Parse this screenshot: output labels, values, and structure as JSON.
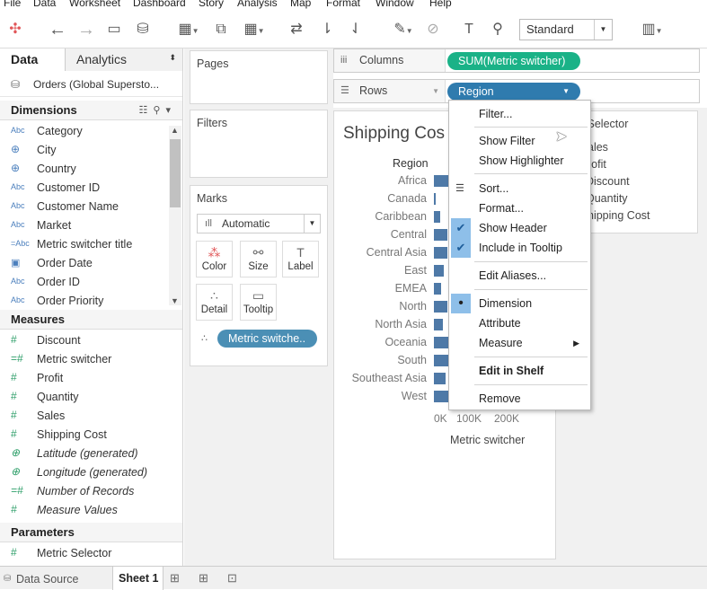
{
  "menubar": [
    "File",
    "Data",
    "Worksheet",
    "Dashboard",
    "Story",
    "Analysis",
    "Map",
    "Format",
    "Window",
    "Help"
  ],
  "toolbar": {
    "fit_value": "Standard"
  },
  "left_pane": {
    "tab_data": "Data",
    "tab_analytics": "Analytics",
    "datasource": "Orders (Global Supersto...",
    "dimensions_header": "Dimensions",
    "dimensions": [
      {
        "type": "Abc",
        "label": "Category"
      },
      {
        "type": "globe",
        "label": "City"
      },
      {
        "type": "globe",
        "label": "Country"
      },
      {
        "type": "Abc",
        "label": "Customer ID"
      },
      {
        "type": "Abc",
        "label": "Customer Name"
      },
      {
        "type": "Abc",
        "label": "Market"
      },
      {
        "type": "=Abc",
        "label": "Metric switcher title"
      },
      {
        "type": "calendar",
        "label": "Order Date"
      },
      {
        "type": "Abc",
        "label": "Order ID"
      },
      {
        "type": "Abc",
        "label": "Order Priority"
      }
    ],
    "measures_header": "Measures",
    "measures": [
      {
        "label": "Discount",
        "italic": false
      },
      {
        "label": "Metric switcher",
        "italic": false
      },
      {
        "label": "Profit",
        "italic": false
      },
      {
        "label": "Quantity",
        "italic": false
      },
      {
        "label": "Sales",
        "italic": false
      },
      {
        "label": "Shipping Cost",
        "italic": false
      },
      {
        "label": "Latitude (generated)",
        "italic": true
      },
      {
        "label": "Longitude (generated)",
        "italic": true
      },
      {
        "label": "Number of Records",
        "italic": true
      },
      {
        "label": "Measure Values",
        "italic": true
      }
    ],
    "parameters_header": "Parameters",
    "parameters": [
      {
        "label": "Metric Selector"
      }
    ]
  },
  "cards": {
    "pages": "Pages",
    "filters": "Filters",
    "marks": "Marks",
    "mark_type": "Automatic",
    "buttons": {
      "color": "Color",
      "size": "Size",
      "label": "Label",
      "detail": "Detail",
      "tooltip": "Tooltip"
    },
    "marks_pill": "Metric switche.."
  },
  "shelves": {
    "columns_label": "Columns",
    "columns_pill": "SUM(Metric switcher)",
    "rows_label": "Rows",
    "rows_pill": "Region"
  },
  "view": {
    "title": "Shipping Cos",
    "row_header": "Region"
  },
  "chart_data": {
    "type": "bar",
    "categories": [
      "Africa",
      "Canada",
      "Caribbean",
      "Central",
      "Central Asia",
      "East",
      "EMEA",
      "North",
      "North Asia",
      "Oceania",
      "South",
      "Southeast Asia",
      "West"
    ],
    "values": [
      48000,
      3000,
      17000,
      35000,
      36000,
      26000,
      19000,
      35000,
      24000,
      38000,
      49000,
      30000,
      38000
    ],
    "xlabel": "Metric switcher",
    "x_ticks": [
      "0K",
      "100K",
      "200K"
    ],
    "xlim": [
      0,
      250000
    ],
    "bar_color": "#4e79a7",
    "partially_hidden_by_menu": true
  },
  "parameter_card": {
    "title": "ic Selector",
    "options": [
      "ales",
      "rofit",
      "Discount",
      "Quantity",
      "hipping Cost"
    ]
  },
  "context_menu": {
    "items": [
      {
        "label": "Filter...",
        "checked": false
      },
      {
        "label": "Show Filter",
        "checked": false
      },
      {
        "label": "Show Highlighter",
        "checked": false
      },
      {
        "label": "Sort...",
        "checked": false
      },
      {
        "label": "Format...",
        "checked": false
      },
      {
        "label": "Show Header",
        "checked": true
      },
      {
        "label": "Include in Tooltip",
        "checked": true
      },
      {
        "label": "Edit Aliases...",
        "checked": false
      },
      {
        "label": "Dimension",
        "checked": true
      },
      {
        "label": "Attribute",
        "checked": false
      },
      {
        "label": "Measure",
        "checked": false
      },
      {
        "label": "Edit in Shelf",
        "checked": false
      },
      {
        "label": "Remove",
        "checked": false
      }
    ]
  },
  "status_bar": {
    "data_source": "Data Source",
    "sheet": "Sheet 1"
  },
  "colors": {
    "columns_pill": "#1ab287",
    "rows_pill": "#2f7bae",
    "marks_pill": "#4b8fb5",
    "menu_check_bg": "#8ebfe9"
  }
}
